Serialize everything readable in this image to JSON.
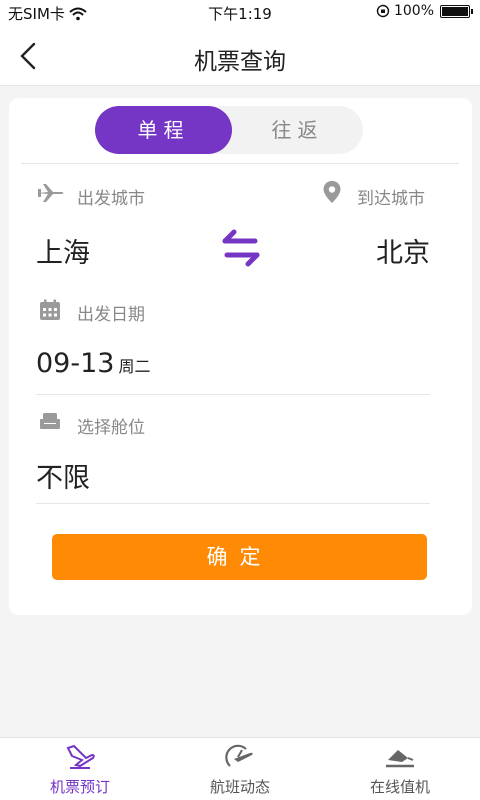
{
  "status_bar": {
    "carrier": "无SIM卡",
    "time": "下午1:19",
    "battery": "100%"
  },
  "nav": {
    "title": "机票查询",
    "back_icon": "chevron-left-icon"
  },
  "trip_type": {
    "options": [
      "单程",
      "往返"
    ],
    "selected": "单程"
  },
  "route": {
    "from_label": "出发城市",
    "from_city": "上海",
    "to_label": "到达城市",
    "to_city": "北京"
  },
  "date": {
    "label": "出发日期",
    "value": "09-13",
    "weekday": "周二"
  },
  "cabin": {
    "label": "选择舱位",
    "value": "不限"
  },
  "confirm_label": "确定",
  "tabs": [
    {
      "label": "机票预订",
      "icon": "flight-booking-icon",
      "active": true
    },
    {
      "label": "航班动态",
      "icon": "flight-status-icon",
      "active": false
    },
    {
      "label": "在线值机",
      "icon": "check-in-icon",
      "active": false
    }
  ],
  "colors": {
    "accent": "#7535c5",
    "confirm": "#ff8a06",
    "label_gray": "#888888"
  }
}
